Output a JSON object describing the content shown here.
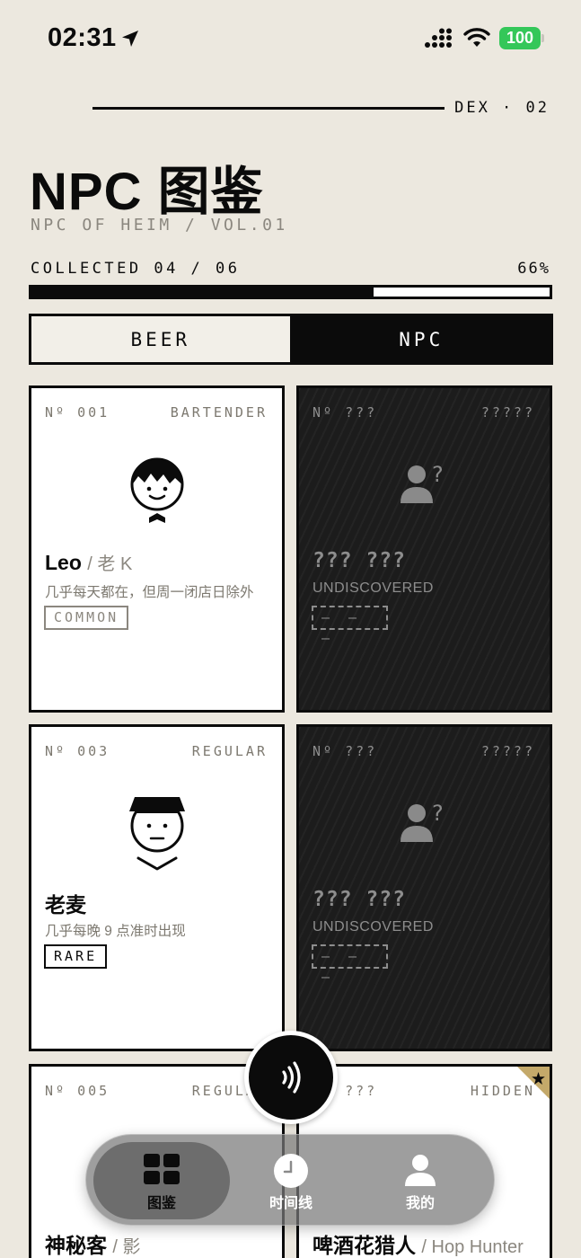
{
  "status": {
    "time": "02:31",
    "battery": "100"
  },
  "header": {
    "dex_tag": "DEX · 02",
    "title": "NPC 图鉴",
    "subtitle": "NPC OF HEIM / VOL.01"
  },
  "progress": {
    "collected": "COLLECTED 04 / 06",
    "percent": "66%",
    "fraction": 0.66
  },
  "tabs": [
    {
      "label": "BEER",
      "active": false
    },
    {
      "label": "NPC",
      "active": true
    }
  ],
  "cards": [
    {
      "no": "Nº 001",
      "role": "BARTENDER",
      "name": "Leo",
      "alias": "/ 老 K",
      "desc": "几乎每天都在，但周一闭店日除外",
      "badge": "COMMON"
    },
    {
      "no": "Nº ???",
      "role": "?????",
      "name": "??? ???",
      "desc": "UNDISCOVERED",
      "badge": "– – –"
    },
    {
      "no": "Nº 003",
      "role": "REGULAR",
      "name": "老麦",
      "desc": "几乎每晚 9 点准时出现",
      "badge": "RARE"
    },
    {
      "no": "Nº ???",
      "role": "?????",
      "name": "??? ???",
      "desc": "UNDISCOVERED",
      "badge": "– – –"
    },
    {
      "no": "Nº 005",
      "role": "REGULAR",
      "name": "神秘客",
      "alias": "/ 影"
    },
    {
      "no": "Nº ???",
      "role": "HIDDEN",
      "name": "啤酒花猎人",
      "alias": "/ Hop Hunter"
    }
  ],
  "nav": {
    "items": [
      {
        "label": "图鉴",
        "icon": "grid-icon"
      },
      {
        "label": "时间线",
        "icon": "clock-icon"
      },
      {
        "label": "我的",
        "icon": "user-icon"
      }
    ]
  },
  "colors": {
    "background": "#ece8df",
    "ink": "#0b0b0b",
    "muted": "#8b877f",
    "gold": "#c4a96a",
    "battery": "#34c759"
  }
}
